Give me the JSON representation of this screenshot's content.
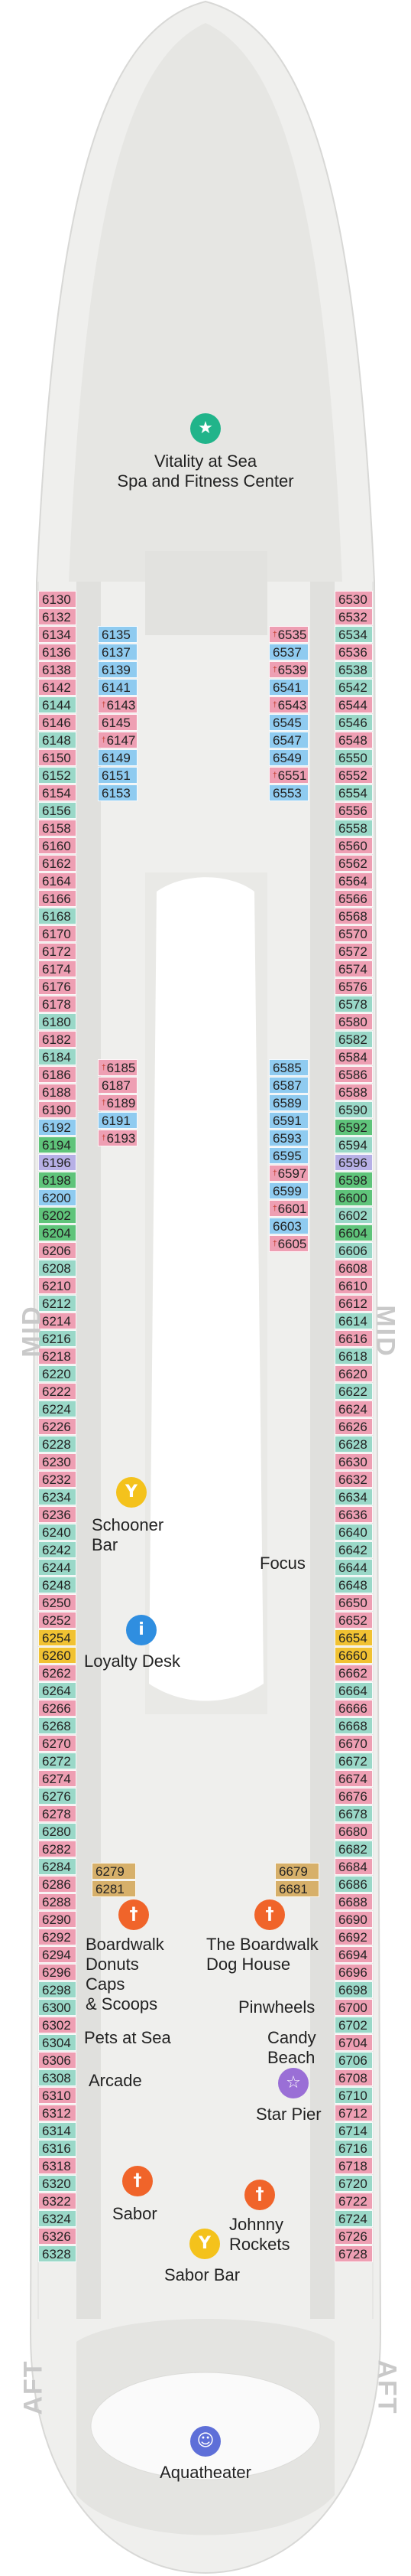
{
  "colors": {
    "hull": "#eeeeec",
    "deck": "#e3e3e1",
    "pink": "#ee9fb3",
    "blue": "#8fcbf0",
    "teal": "#9ad8c8",
    "green": "#5fc47a",
    "gold": "#f1c232",
    "tan": "#d7b06a",
    "lavender": "#b7b0e6",
    "dining_orange": "#f0642a",
    "info_blue": "#2f8ee0",
    "bar_yellow": "#f4c21c",
    "vitality_green": "#21b48a",
    "theater_blue": "#5e6fd8",
    "star_purple": "#9a6fd6"
  },
  "side_labels": {
    "mid_left": "MID",
    "mid_right": "MID",
    "aft_left": "AFT",
    "aft_right": "AFT"
  },
  "pois": [
    {
      "id": "vitality",
      "icon": "fitness-icon",
      "line1": "Vitality at Sea",
      "line2": "Spa and Fitness Center"
    },
    {
      "id": "schooner",
      "icon": "cocktail-icon",
      "line1": "Schooner",
      "line2": "Bar"
    },
    {
      "id": "focus",
      "icon": "",
      "line1": "Focus",
      "line2": ""
    },
    {
      "id": "loyalty",
      "icon": "info-icon",
      "line1": "Loyalty Desk",
      "line2": ""
    },
    {
      "id": "donuts",
      "icon": "dining-icon",
      "line1": "Boardwalk",
      "line2": "Donuts",
      "line3": "Caps",
      "line4": "& Scoops"
    },
    {
      "id": "doghouse",
      "icon": "dining-icon",
      "line1": "The Boardwalk",
      "line2": "Dog House"
    },
    {
      "id": "pinwheels",
      "icon": "",
      "line1": "Pinwheels",
      "line2": ""
    },
    {
      "id": "pets",
      "icon": "",
      "line1": "Pets at Sea",
      "line2": ""
    },
    {
      "id": "candy",
      "icon": "",
      "line1": "Candy",
      "line2": "Beach"
    },
    {
      "id": "arcade",
      "icon": "",
      "line1": "Arcade",
      "line2": ""
    },
    {
      "id": "starpier",
      "icon": "star-icon",
      "line1": "Star Pier",
      "line2": ""
    },
    {
      "id": "sabor",
      "icon": "dining-icon",
      "line1": "Sabor",
      "line2": ""
    },
    {
      "id": "johnny",
      "icon": "dining-icon",
      "line1": "Johnny",
      "line2": "Rockets"
    },
    {
      "id": "saborbar",
      "icon": "cocktail-icon",
      "line1": "Sabor Bar",
      "line2": ""
    },
    {
      "id": "aquatheater",
      "icon": "theater-icon",
      "line1": "Aquatheater",
      "line2": ""
    }
  ],
  "cabins": {
    "port_outer": [
      [
        "6130",
        "pink",
        ""
      ],
      [
        "6132",
        "pink",
        ""
      ],
      [
        "6134",
        "pink",
        ""
      ],
      [
        "6136",
        "pink",
        ""
      ],
      [
        "6138",
        "pink",
        ""
      ],
      [
        "6142",
        "pink",
        ""
      ],
      [
        "6144",
        "teal",
        ""
      ],
      [
        "6146",
        "pink",
        ""
      ],
      [
        "6148",
        "teal",
        ""
      ],
      [
        "6150",
        "pink",
        ""
      ],
      [
        "6152",
        "teal",
        ""
      ],
      [
        "6154",
        "pink",
        ""
      ],
      [
        "6156",
        "teal",
        ""
      ],
      [
        "6158",
        "pink",
        ""
      ],
      [
        "6160",
        "pink",
        ""
      ],
      [
        "6162",
        "pink",
        ""
      ],
      [
        "6164",
        "pink",
        ""
      ],
      [
        "6166",
        "pink",
        ""
      ],
      [
        "6168",
        "teal",
        ""
      ],
      [
        "6170",
        "pink",
        ""
      ],
      [
        "6172",
        "pink",
        ""
      ],
      [
        "6174",
        "pink",
        ""
      ],
      [
        "6176",
        "pink",
        ""
      ],
      [
        "6178",
        "pink",
        ""
      ],
      [
        "6180",
        "teal",
        ""
      ],
      [
        "6182",
        "pink",
        ""
      ],
      [
        "6184",
        "teal",
        ""
      ],
      [
        "6186",
        "pink",
        ""
      ],
      [
        "6188",
        "pink",
        ""
      ],
      [
        "6190",
        "pink",
        ""
      ],
      [
        "6192",
        "blue",
        ""
      ],
      [
        "6194",
        "green",
        ""
      ],
      [
        "6196",
        "lav",
        ""
      ],
      [
        "6198",
        "green",
        ""
      ],
      [
        "6200",
        "blue",
        ""
      ],
      [
        "6202",
        "green",
        ""
      ],
      [
        "6204",
        "green",
        ""
      ],
      [
        "6206",
        "pink",
        ""
      ],
      [
        "6208",
        "teal",
        ""
      ],
      [
        "6210",
        "pink",
        ""
      ],
      [
        "6212",
        "teal",
        ""
      ],
      [
        "6214",
        "pink",
        ""
      ],
      [
        "6216",
        "teal",
        ""
      ],
      [
        "6218",
        "pink",
        ""
      ],
      [
        "6220",
        "teal",
        ""
      ],
      [
        "6222",
        "pink",
        ""
      ],
      [
        "6224",
        "teal",
        ""
      ],
      [
        "6226",
        "pink",
        ""
      ],
      [
        "6228",
        "teal",
        ""
      ],
      [
        "6230",
        "pink",
        ""
      ],
      [
        "6232",
        "pink",
        ""
      ],
      [
        "6234",
        "teal",
        ""
      ],
      [
        "6236",
        "pink",
        ""
      ],
      [
        "6240",
        "teal",
        ""
      ],
      [
        "6242",
        "teal",
        ""
      ],
      [
        "6244",
        "teal",
        ""
      ],
      [
        "6248",
        "teal",
        ""
      ],
      [
        "6250",
        "pink",
        ""
      ],
      [
        "6252",
        "pink",
        ""
      ],
      [
        "6254",
        "gold",
        ""
      ],
      [
        "6260",
        "gold",
        ""
      ],
      [
        "6262",
        "pink",
        ""
      ],
      [
        "6264",
        "teal",
        ""
      ],
      [
        "6266",
        "pink",
        ""
      ],
      [
        "6268",
        "teal",
        ""
      ],
      [
        "6270",
        "pink",
        ""
      ],
      [
        "6272",
        "teal",
        ""
      ],
      [
        "6274",
        "pink",
        ""
      ],
      [
        "6276",
        "teal",
        ""
      ],
      [
        "6278",
        "pink",
        ""
      ],
      [
        "6280",
        "teal",
        ""
      ],
      [
        "6282",
        "pink",
        ""
      ],
      [
        "6284",
        "teal",
        ""
      ],
      [
        "6286",
        "pink",
        ""
      ],
      [
        "6288",
        "pink",
        ""
      ],
      [
        "6290",
        "pink",
        ""
      ],
      [
        "6292",
        "pink",
        ""
      ],
      [
        "6294",
        "pink",
        ""
      ],
      [
        "6296",
        "pink",
        ""
      ],
      [
        "6298",
        "teal",
        ""
      ],
      [
        "6300",
        "teal",
        ""
      ],
      [
        "6302",
        "pink",
        ""
      ],
      [
        "6304",
        "teal",
        ""
      ],
      [
        "6306",
        "pink",
        ""
      ],
      [
        "6308",
        "teal",
        ""
      ],
      [
        "6310",
        "pink",
        ""
      ],
      [
        "6312",
        "pink",
        ""
      ],
      [
        "6314",
        "teal",
        ""
      ],
      [
        "6316",
        "teal",
        ""
      ],
      [
        "6318",
        "pink",
        ""
      ],
      [
        "6320",
        "teal",
        ""
      ],
      [
        "6322",
        "pink",
        ""
      ],
      [
        "6324",
        "teal",
        ""
      ],
      [
        "6326",
        "pink",
        ""
      ],
      [
        "6328",
        "teal",
        ""
      ]
    ],
    "starboard_outer": [
      [
        "6530",
        "pink",
        ""
      ],
      [
        "6532",
        "pink",
        ""
      ],
      [
        "6534",
        "teal",
        ""
      ],
      [
        "6536",
        "pink",
        ""
      ],
      [
        "6538",
        "teal",
        ""
      ],
      [
        "6542",
        "teal",
        ""
      ],
      [
        "6544",
        "pink",
        ""
      ],
      [
        "6546",
        "teal",
        ""
      ],
      [
        "6548",
        "pink",
        ""
      ],
      [
        "6550",
        "teal",
        ""
      ],
      [
        "6552",
        "pink",
        ""
      ],
      [
        "6554",
        "teal",
        ""
      ],
      [
        "6556",
        "pink",
        ""
      ],
      [
        "6558",
        "teal",
        ""
      ],
      [
        "6560",
        "pink",
        ""
      ],
      [
        "6562",
        "pink",
        ""
      ],
      [
        "6564",
        "pink",
        ""
      ],
      [
        "6566",
        "pink",
        ""
      ],
      [
        "6568",
        "pink",
        ""
      ],
      [
        "6570",
        "pink",
        ""
      ],
      [
        "6572",
        "pink",
        ""
      ],
      [
        "6574",
        "pink",
        ""
      ],
      [
        "6576",
        "pink",
        ""
      ],
      [
        "6578",
        "teal",
        ""
      ],
      [
        "6580",
        "pink",
        ""
      ],
      [
        "6582",
        "teal",
        ""
      ],
      [
        "6584",
        "pink",
        ""
      ],
      [
        "6586",
        "pink",
        ""
      ],
      [
        "6588",
        "pink",
        ""
      ],
      [
        "6590",
        "teal",
        ""
      ],
      [
        "6592",
        "green",
        ""
      ],
      [
        "6594",
        "teal",
        ""
      ],
      [
        "6596",
        "lav",
        ""
      ],
      [
        "6598",
        "green",
        ""
      ],
      [
        "6600",
        "green",
        ""
      ],
      [
        "6602",
        "teal",
        ""
      ],
      [
        "6604",
        "green",
        ""
      ],
      [
        "6606",
        "teal",
        ""
      ],
      [
        "6608",
        "pink",
        ""
      ],
      [
        "6610",
        "pink",
        ""
      ],
      [
        "6612",
        "pink",
        ""
      ],
      [
        "6614",
        "teal",
        ""
      ],
      [
        "6616",
        "pink",
        ""
      ],
      [
        "6618",
        "teal",
        ""
      ],
      [
        "6620",
        "pink",
        ""
      ],
      [
        "6622",
        "teal",
        ""
      ],
      [
        "6624",
        "pink",
        ""
      ],
      [
        "6626",
        "pink",
        ""
      ],
      [
        "6628",
        "teal",
        ""
      ],
      [
        "6630",
        "pink",
        ""
      ],
      [
        "6632",
        "pink",
        ""
      ],
      [
        "6634",
        "teal",
        ""
      ],
      [
        "6636",
        "pink",
        ""
      ],
      [
        "6640",
        "teal",
        ""
      ],
      [
        "6642",
        "teal",
        ""
      ],
      [
        "6644",
        "teal",
        ""
      ],
      [
        "6648",
        "teal",
        ""
      ],
      [
        "6650",
        "pink",
        ""
      ],
      [
        "6652",
        "pink",
        ""
      ],
      [
        "6654",
        "gold",
        ""
      ],
      [
        "6660",
        "gold",
        ""
      ],
      [
        "6662",
        "pink",
        ""
      ],
      [
        "6664",
        "teal",
        ""
      ],
      [
        "6666",
        "pink",
        ""
      ],
      [
        "6668",
        "teal",
        ""
      ],
      [
        "6670",
        "pink",
        ""
      ],
      [
        "6672",
        "teal",
        ""
      ],
      [
        "6674",
        "pink",
        ""
      ],
      [
        "6676",
        "pink",
        ""
      ],
      [
        "6678",
        "teal",
        ""
      ],
      [
        "6680",
        "pink",
        ""
      ],
      [
        "6682",
        "teal",
        ""
      ],
      [
        "6684",
        "pink",
        ""
      ],
      [
        "6686",
        "teal",
        ""
      ],
      [
        "6688",
        "pink",
        ""
      ],
      [
        "6690",
        "pink",
        ""
      ],
      [
        "6692",
        "pink",
        ""
      ],
      [
        "6694",
        "pink",
        ""
      ],
      [
        "6696",
        "pink",
        ""
      ],
      [
        "6698",
        "teal",
        ""
      ],
      [
        "6700",
        "pink",
        ""
      ],
      [
        "6702",
        "teal",
        ""
      ],
      [
        "6704",
        "pink",
        ""
      ],
      [
        "6706",
        "teal",
        ""
      ],
      [
        "6708",
        "pink",
        ""
      ],
      [
        "6710",
        "teal",
        ""
      ],
      [
        "6712",
        "pink",
        ""
      ],
      [
        "6714",
        "teal",
        ""
      ],
      [
        "6716",
        "teal",
        ""
      ],
      [
        "6718",
        "pink",
        ""
      ],
      [
        "6720",
        "teal",
        ""
      ],
      [
        "6722",
        "pink",
        ""
      ],
      [
        "6724",
        "teal",
        ""
      ],
      [
        "6726",
        "pink",
        ""
      ],
      [
        "6728",
        "pink",
        ""
      ]
    ],
    "port_inner_fore": [
      [
        "6135",
        "blue",
        ""
      ],
      [
        "6137",
        "blue",
        ""
      ],
      [
        "6139",
        "blue",
        ""
      ],
      [
        "6141",
        "blue",
        ""
      ],
      [
        "6143",
        "pink",
        "†"
      ],
      [
        "6145",
        "pink",
        ""
      ],
      [
        "6147",
        "pink",
        "†"
      ],
      [
        "6149",
        "blue",
        ""
      ],
      [
        "6151",
        "blue",
        ""
      ],
      [
        "6153",
        "blue",
        ""
      ]
    ],
    "starboard_inner_fore": [
      [
        "6535",
        "pink",
        "†"
      ],
      [
        "6537",
        "blue",
        ""
      ],
      [
        "6539",
        "pink",
        "†"
      ],
      [
        "6541",
        "blue",
        ""
      ],
      [
        "6543",
        "pink",
        "†"
      ],
      [
        "6545",
        "blue",
        ""
      ],
      [
        "6547",
        "blue",
        ""
      ],
      [
        "6549",
        "blue",
        ""
      ],
      [
        "6551",
        "pink",
        "†"
      ],
      [
        "6553",
        "blue",
        ""
      ]
    ],
    "port_inner_mid": [
      [
        "6185",
        "pink",
        "†"
      ],
      [
        "6187",
        "pink",
        ""
      ],
      [
        "6189",
        "pink",
        "†"
      ],
      [
        "6191",
        "blue",
        ""
      ],
      [
        "6193",
        "pink",
        "†"
      ]
    ],
    "starboard_inner_mid": [
      [
        "6585",
        "blue",
        ""
      ],
      [
        "6587",
        "blue",
        ""
      ],
      [
        "6589",
        "blue",
        ""
      ],
      [
        "6591",
        "blue",
        ""
      ],
      [
        "6593",
        "blue",
        ""
      ],
      [
        "6595",
        "blue",
        ""
      ],
      [
        "6597",
        "pink",
        "†"
      ],
      [
        "6599",
        "blue",
        ""
      ],
      [
        "6601",
        "pink",
        "†"
      ],
      [
        "6603",
        "blue",
        ""
      ],
      [
        "6605",
        "pink",
        "†"
      ]
    ],
    "port_boardwalk": [
      [
        "6279",
        "tan",
        ""
      ],
      [
        "6281",
        "tan",
        ""
      ]
    ],
    "starboard_boardwalk": [
      [
        "6679",
        "tan",
        ""
      ],
      [
        "6681",
        "tan",
        ""
      ]
    ]
  }
}
